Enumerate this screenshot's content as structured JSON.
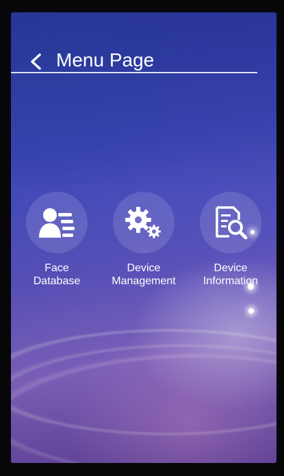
{
  "header": {
    "back_label": "<",
    "title": "Menu Page"
  },
  "menu": {
    "items": [
      {
        "line1": "Face",
        "line2": "Database",
        "icon": "face-database-icon"
      },
      {
        "line1": "Device",
        "line2": "Management",
        "icon": "gears-icon"
      },
      {
        "line1": "Device",
        "line2": "Information",
        "icon": "document-search-icon"
      }
    ]
  },
  "colors": {
    "text": "#ffffff",
    "background_top": "#2b3aa8",
    "background_bottom": "#8a6fcf",
    "icon_circle": "rgba(255,255,255,0.13)"
  }
}
